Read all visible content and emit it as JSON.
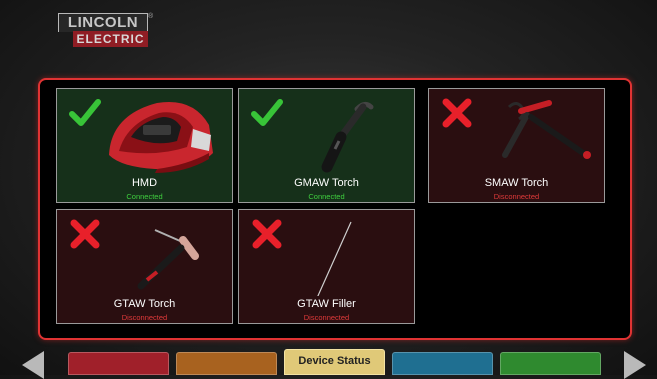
{
  "brand": {
    "line1": "LINCOLN",
    "line2": "ELECTRIC",
    "mark": "®"
  },
  "devices": [
    {
      "name": "HMD",
      "status": "Connected",
      "state": "connected",
      "icon": "welding-helmet-icon"
    },
    {
      "name": "GMAW Torch",
      "status": "Connected",
      "state": "connected",
      "icon": "gmaw-torch-icon"
    },
    {
      "name": "SMAW Torch",
      "status": "Disconnected",
      "state": "disconnected",
      "icon": "smaw-stinger-icon"
    },
    {
      "name": "GTAW Torch",
      "status": "Disconnected",
      "state": "disconnected",
      "icon": "gtaw-torch-icon"
    },
    {
      "name": "GTAW Filler",
      "status": "Disconnected",
      "state": "disconnected",
      "icon": "filler-rod-icon"
    }
  ],
  "nav": {
    "tabs": [
      {
        "label": "",
        "color": "#a0202a"
      },
      {
        "label": "",
        "color": "#a8621f"
      },
      {
        "label": "Device Status",
        "color": "#e0c978"
      },
      {
        "label": "",
        "color": "#1f6f91"
      },
      {
        "label": "",
        "color": "#2f8a2f"
      }
    ]
  },
  "colors": {
    "accent": "#e03333",
    "connected": "#3fcf3f",
    "disconnected": "#e03a3a"
  }
}
